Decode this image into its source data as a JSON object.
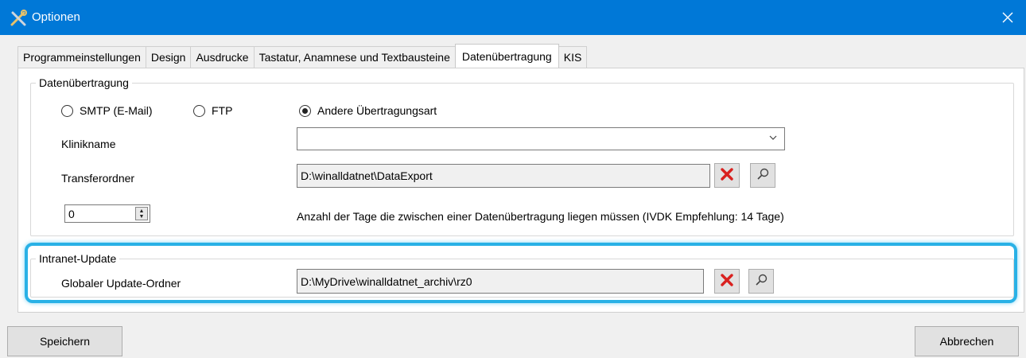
{
  "window": {
    "title": "Optionen",
    "app_icon": "tools-icon",
    "close_icon": "close-icon"
  },
  "tabs": [
    {
      "label": "Programmeinstellungen",
      "active": false
    },
    {
      "label": "Design",
      "active": false
    },
    {
      "label": "Ausdrucke",
      "active": false
    },
    {
      "label": "Tastatur, Anamnese und Textbausteine",
      "active": false
    },
    {
      "label": "Datenübertragung",
      "active": true
    },
    {
      "label": "KIS",
      "active": false
    }
  ],
  "transfer": {
    "group_label": "Datenübertragung",
    "radios": [
      {
        "label": "SMTP (E-Mail)",
        "selected": false
      },
      {
        "label": "FTP",
        "selected": false
      },
      {
        "label": "Andere Übertragungsart",
        "selected": true
      }
    ],
    "klinikname_label": "Klinikname",
    "klinikname_value": "",
    "transferordner_label": "Transferordner",
    "transferordner_value": "D:\\winalldatnet\\DataExport",
    "days_value": "0",
    "days_label": "Anzahl der Tage die zwischen einer Datenübertragung liegen müssen (IVDK Empfehlung: 14 Tage)"
  },
  "intranet": {
    "group_label": "Intranet-Update",
    "folder_label": "Globaler Update-Ordner",
    "folder_value": "D:\\MyDrive\\winalldatnet_archiv\\rz0"
  },
  "buttons": {
    "save_label": "Speichern",
    "cancel_label": "Abbrechen"
  },
  "colors": {
    "titlebar": "#0078d7",
    "highlight": "#29b1e6",
    "delete_red": "#d9211f"
  }
}
